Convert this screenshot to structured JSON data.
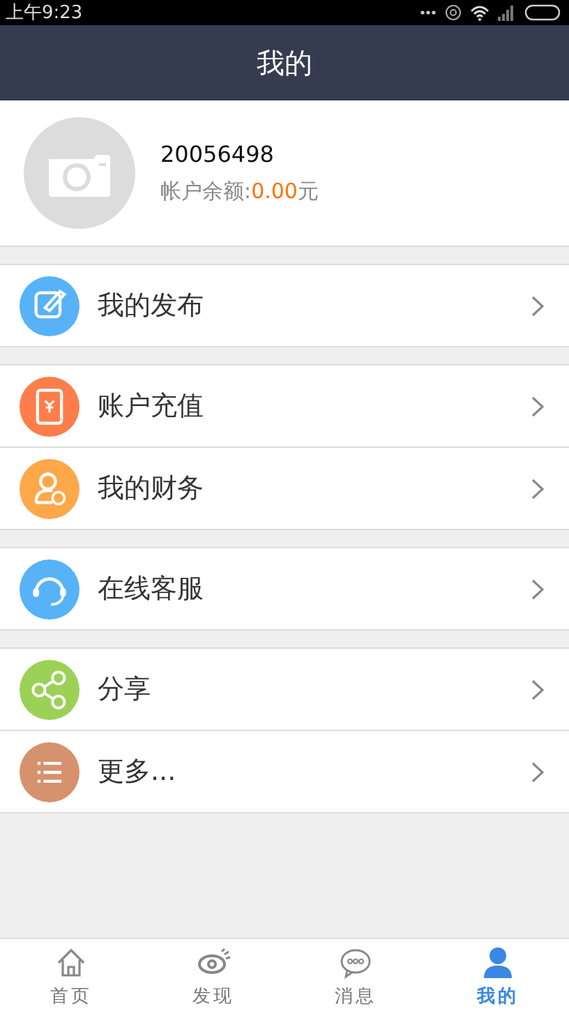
{
  "status_bar": {
    "time": "上午9:23"
  },
  "header": {
    "title": "我的"
  },
  "profile": {
    "user_id": "20056498",
    "balance_label": "帐户余额:",
    "balance_value": "0.00",
    "balance_unit": "元"
  },
  "menu_groups": [
    [
      {
        "label": "我的发布",
        "kind": "edit",
        "color": "#57b2f8"
      }
    ],
    [
      {
        "label": "账户充值",
        "kind": "recharge",
        "color": "#fd7e4a"
      },
      {
        "label": "我的财务",
        "kind": "finance",
        "color": "#fea84a"
      }
    ],
    [
      {
        "label": "在线客服",
        "kind": "service",
        "color": "#57b2f8"
      }
    ],
    [
      {
        "label": "分享",
        "kind": "share",
        "color": "#9cd157"
      },
      {
        "label": "更多...",
        "kind": "more",
        "color": "#d6916d"
      }
    ]
  ],
  "tab_bar": [
    {
      "label": "首页",
      "kind": "home",
      "selected": false
    },
    {
      "label": "发现",
      "kind": "discover",
      "selected": false
    },
    {
      "label": "消息",
      "kind": "message",
      "selected": false
    },
    {
      "label": "我的",
      "kind": "me",
      "selected": true
    }
  ]
}
